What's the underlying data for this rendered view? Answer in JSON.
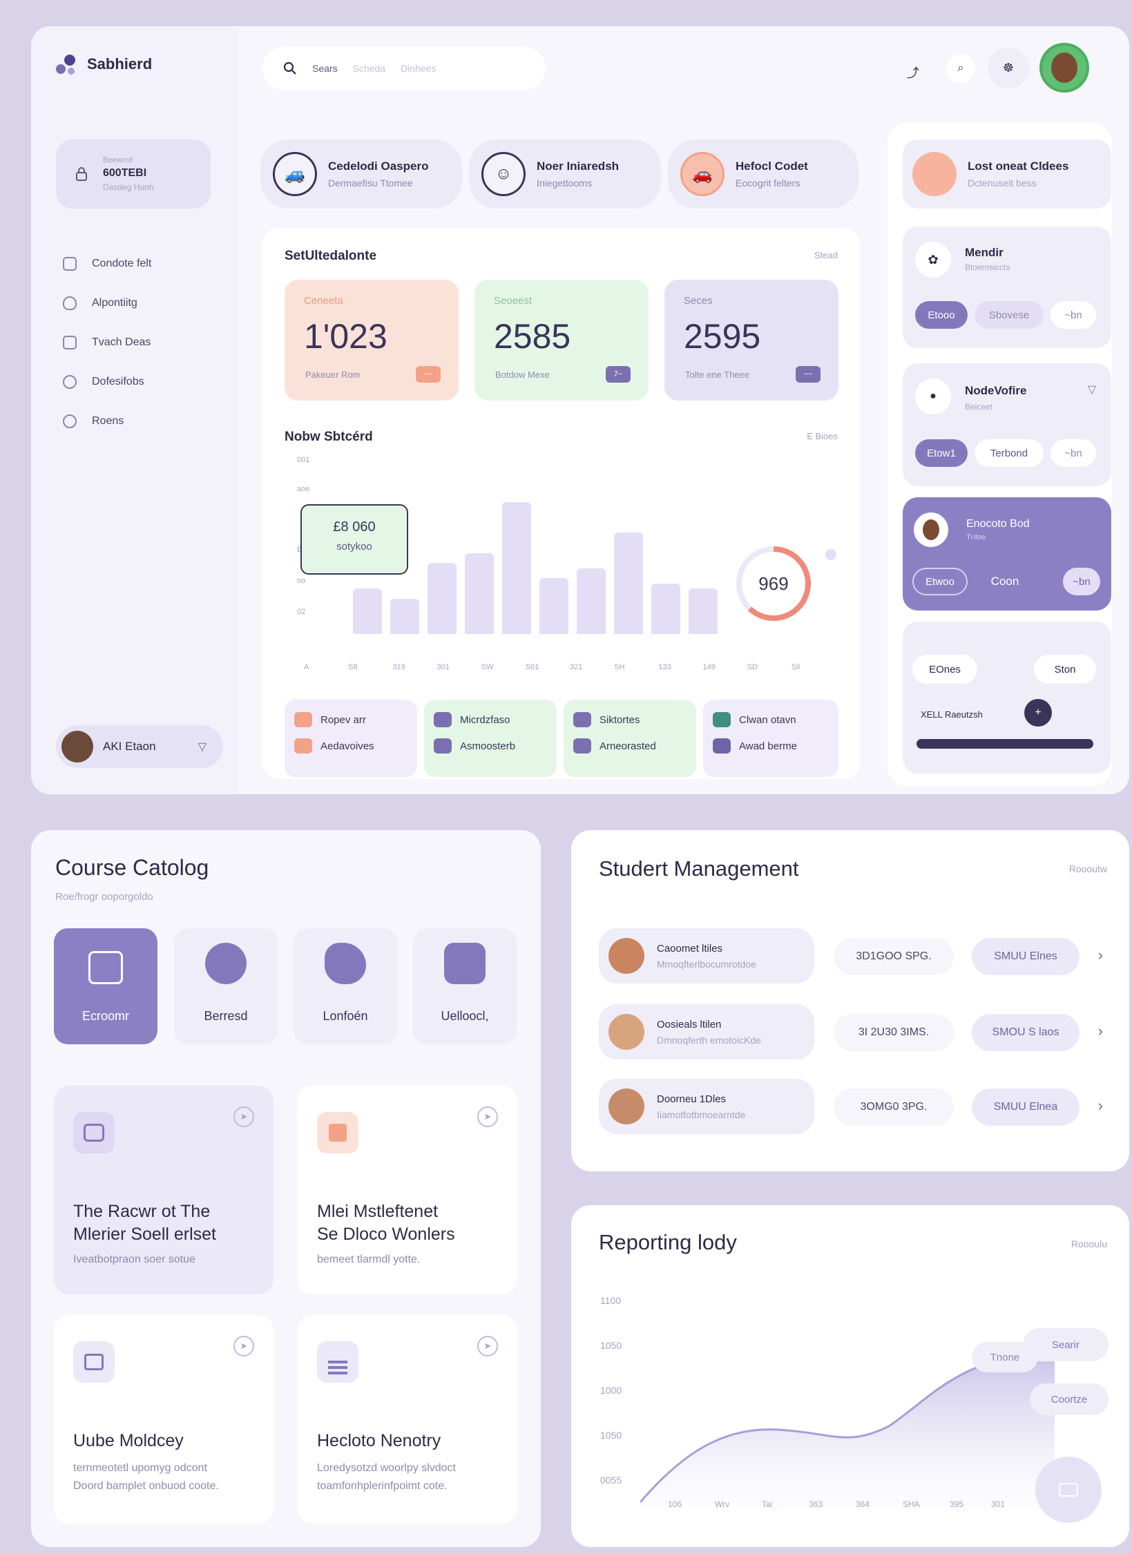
{
  "app": {
    "name": "Sabhierd"
  },
  "search": {
    "label": "Sears",
    "tabs": [
      "Scheda",
      "Dinhees"
    ]
  },
  "sidebar": {
    "account": {
      "line1": "Beewrcd",
      "line2": "600TEBI",
      "line3": "Dasdeg Hunh"
    },
    "items": [
      {
        "label": "Condote felt",
        "icon": "calendar-icon"
      },
      {
        "label": "Alpontiitg",
        "icon": "shield-icon"
      },
      {
        "label": "Tvach Deas",
        "icon": "file-icon"
      },
      {
        "label": "Dofesifobs",
        "icon": "settings-icon"
      },
      {
        "label": "Roens",
        "icon": "folder-icon"
      }
    ],
    "user": {
      "name": "AKI Etaon"
    }
  },
  "people_chips": [
    {
      "name": "Cedelodi Oaspero",
      "sub": "Dermaefisu Ttomee"
    },
    {
      "name": "Noer Iniaredsh",
      "sub": "Iniegettooms"
    },
    {
      "name": "Hefocl Codet",
      "sub": "Eocogrit felters"
    }
  ],
  "right_chip": {
    "name": "Lost oneat Cldees",
    "sub": "Dctenuseit bess"
  },
  "stats_section": {
    "title": "SetUltedalonte",
    "link": "Stead",
    "cards": [
      {
        "label": "Ceneeta",
        "value": "1'023",
        "sub": "Pakeuer Rom",
        "tag": "~~",
        "color": "#fbe2d9",
        "tag_color": "#f2a287"
      },
      {
        "label": "Seoeest",
        "value": "2585",
        "sub": "Botdow Mexe",
        "tag": "7~",
        "color": "#e4f7e6",
        "tag_color": "#7a70b0"
      },
      {
        "label": "Seces",
        "value": "2595",
        "sub": "Tolte ene Theee",
        "tag": "~~",
        "color": "#e6e2f6",
        "tag_color": "#7a70b0"
      }
    ]
  },
  "chart_section": {
    "title": "Nobw Sbtcérd",
    "link": "E Bioes",
    "tooltip": {
      "value": "£8 060",
      "label": "sotykoo"
    },
    "gauge": {
      "value": "969",
      "fraction": 0.62
    },
    "y_ticks": [
      "001",
      "aoe",
      "Bl",
      "no",
      "02"
    ],
    "x_ticks": [
      "A",
      "S8",
      "319",
      "301",
      "SW",
      "S01",
      "321",
      "SH",
      "133",
      "149",
      "SD",
      "Sil"
    ]
  },
  "chart_data": {
    "type": "bar",
    "categories": [
      "S8",
      "319",
      "301",
      "SW",
      "S01",
      "321",
      "SH",
      "133",
      "149",
      "SD"
    ],
    "values": [
      18,
      14,
      28,
      32,
      52,
      22,
      26,
      40,
      20,
      18
    ]
  },
  "mini_cards": [
    {
      "top": "Ropev arr",
      "bottom": "Aedavoives",
      "color": "#f1ecfa",
      "ic": "#f2a287"
    },
    {
      "top": "Micrdzfaso",
      "bottom": "Asmoosterb",
      "color": "#e4f7e6",
      "ic": "#7a70b0"
    },
    {
      "top": "Siktortes",
      "bottom": "Arneorasted",
      "color": "#e4f7e6",
      "ic": "#7a70b0"
    },
    {
      "top": "Clwan otavn",
      "bottom": "Awad berme",
      "color": "#f1ecfa",
      "ic": "#3f8f7a"
    }
  ],
  "right_cards": {
    "mendir": {
      "title": "Mendir",
      "sub": "Btoernsiccts",
      "pills": [
        "Etooo",
        "Sbovese",
        "~bn"
      ]
    },
    "nodevolts": {
      "title": "NodeVofire",
      "sub": "Beiceet",
      "pills": [
        "Etow1",
        "Terbond",
        "~bn"
      ]
    },
    "highlight": {
      "title": "Enocoto Bod",
      "sub": "Tntoe",
      "pills": [
        "Etwoo",
        "Coon",
        "~bn"
      ]
    },
    "bottom": {
      "pill1": "EOnes",
      "pill2": "Ston",
      "bar_label": "XELL Raeutzsh",
      "plus": "+"
    }
  },
  "course": {
    "title": "Course Catolog",
    "subtitle": "Roe/frogr ooporgoldo",
    "categories": [
      {
        "label": "Ecroomr",
        "active": true
      },
      {
        "label": "Berresd",
        "active": false
      },
      {
        "label": "Lonfoén",
        "active": false
      },
      {
        "label": "Uelloocl,",
        "active": false
      }
    ],
    "cards": [
      {
        "title1": "The Racwr ot The",
        "title2": "Mlerier Soell erlset",
        "desc1": "Iveatbotpraon soer sotue",
        "desc2": ""
      },
      {
        "title1": "Mlei Mstleftenet",
        "title2": "Se Dloco Wonlers",
        "desc1": "bemeet tlarmdl yotte.",
        "desc2": ""
      },
      {
        "title1": "Uube Moldcey",
        "title2": "",
        "desc1": "ternmeotetl upomyg odcont",
        "desc2": "Doord bamplet onbuod coote."
      },
      {
        "title1": "Hecloto Nenotry",
        "title2": "",
        "desc1": "Loredysotzd woorlpy slvdoct",
        "desc2": "toamfonhplerinfpoimt cote."
      }
    ]
  },
  "students": {
    "title": "Studert Management",
    "link": "Roooutw",
    "rows": [
      {
        "name": "Caoomet ltiles",
        "desc": "Mmoqfterlbocumrotdoe",
        "code": "3D1GOO SPG.",
        "status": "SMUU Elnes"
      },
      {
        "name": "Oosieals ltilen",
        "desc": "Dmnoqferth emotoicKde",
        "code": "3I 2U30 3IMS.",
        "status": "SMOU S laos"
      },
      {
        "name": "Doorneu 1Dles",
        "desc": "Iiamotfotbmoearntde",
        "code": "3OMG0 3PG.",
        "status": "SMUU Elnea"
      }
    ]
  },
  "report": {
    "title": "Reporting lody",
    "link": "Roooulu",
    "y_ticks": [
      "1100",
      "1050",
      "1000",
      "1050",
      "0055"
    ],
    "x_ticks": [
      "106",
      "Wrv",
      "Tai",
      "363",
      "364",
      "SHA",
      "395",
      "301"
    ],
    "tags": [
      "Tnone",
      "Searir",
      "Coortze"
    ]
  }
}
